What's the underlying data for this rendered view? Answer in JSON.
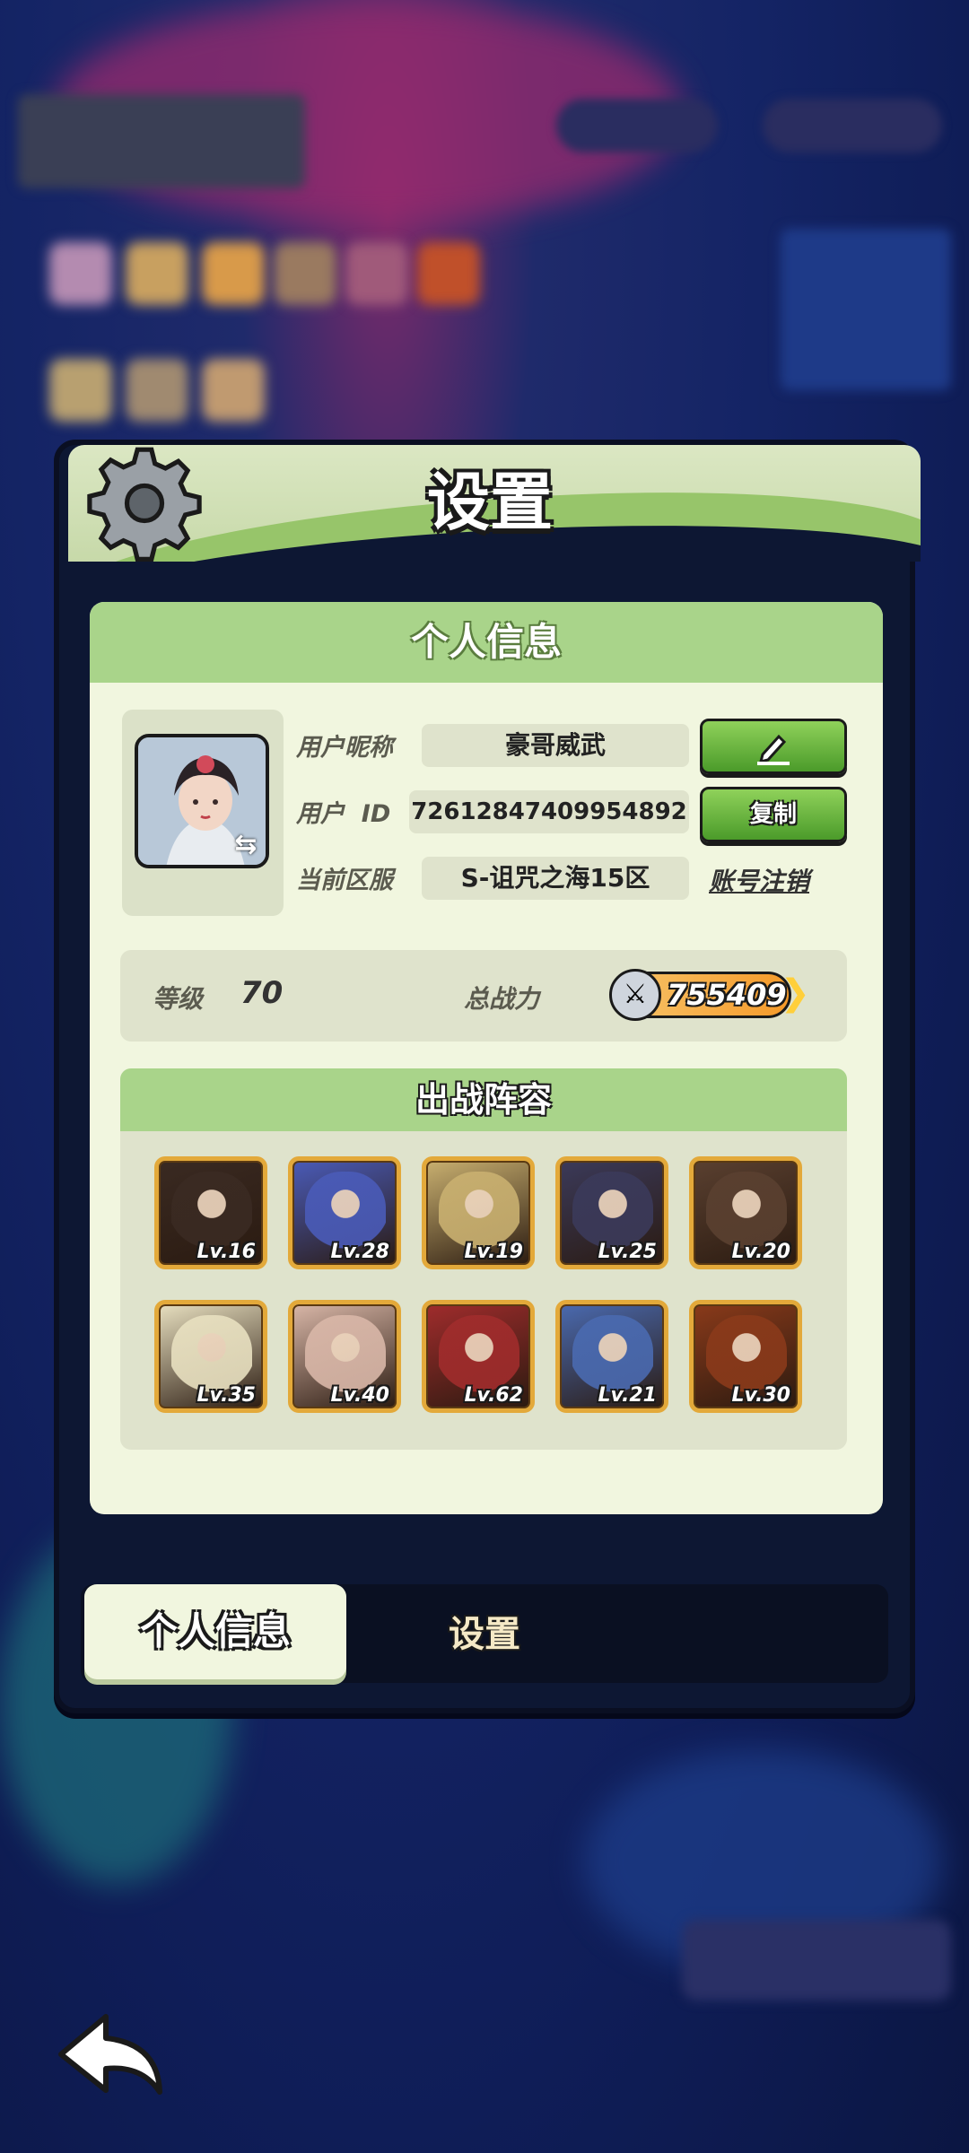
{
  "panel": {
    "title": "设置"
  },
  "personal_info": {
    "section_title": "个人信息",
    "labels": {
      "nickname": "用户昵称",
      "user_id": "用户  ID",
      "server": "当前区服"
    },
    "nickname": "豪哥威武",
    "user_id": "72612847409954892",
    "server": "S-诅咒之海15区",
    "copy_label": "复制",
    "cancel_account_label": "账号注销",
    "edit_icon": "pencil-icon",
    "avatar_swap_icon": "swap-icon"
  },
  "stats": {
    "level_label": "等级",
    "level": "70",
    "power_label": "总战力",
    "power": "755409"
  },
  "lineup": {
    "title": "出战阵容",
    "heroes": [
      {
        "level": "Lv.16",
        "color": "#3a2a22"
      },
      {
        "level": "Lv.28",
        "color": "#4a5bb8"
      },
      {
        "level": "Lv.19",
        "color": "#c9b070"
      },
      {
        "level": "Lv.25",
        "color": "#3b3a5a"
      },
      {
        "level": "Lv.20",
        "color": "#5a4030"
      },
      {
        "level": "Lv.35",
        "color": "#e8e0c0"
      },
      {
        "level": "Lv.40",
        "color": "#d9b7a8"
      },
      {
        "level": "Lv.62",
        "color": "#a02c2c"
      },
      {
        "level": "Lv.21",
        "color": "#4a6ab0"
      },
      {
        "level": "Lv.30",
        "color": "#8a3a1a"
      }
    ]
  },
  "tabs": {
    "active": "个人信息",
    "other": "设置"
  },
  "colors": {
    "accent_green": "#97c56a",
    "panel_dark": "#0d1733",
    "hero_border": "#e3a93a"
  }
}
